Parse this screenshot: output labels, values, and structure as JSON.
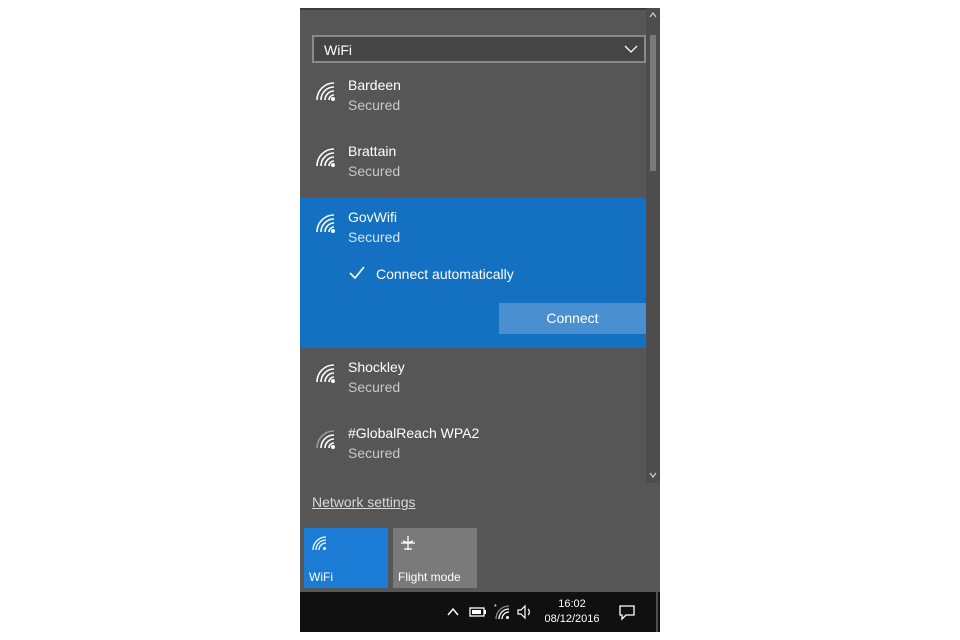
{
  "filter": {
    "value": "WiFi"
  },
  "networks": [
    {
      "name": "Bardeen",
      "status": "Secured"
    },
    {
      "name": "Brattain",
      "status": "Secured"
    },
    {
      "name": "GovWifi",
      "status": "Secured",
      "connect_auto_label": "Connect automatically",
      "connect_auto_checked": true,
      "connect_label": "Connect"
    },
    {
      "name": "Shockley",
      "status": "Secured"
    },
    {
      "name": "#GlobalReach WPA2",
      "status": "Secured"
    }
  ],
  "network_settings_label": "Network settings",
  "quick_actions": [
    {
      "label": "WiFi",
      "icon": "wifi-icon",
      "active": true
    },
    {
      "label": "Flight mode",
      "icon": "airplane-icon",
      "active": false
    }
  ],
  "taskbar": {
    "time": "16:02",
    "date": "08/12/2016",
    "icons": [
      "chevron-up-icon",
      "battery-icon",
      "wifi-icon",
      "volume-icon",
      "action-center-icon"
    ]
  },
  "colors": {
    "accent": "#1470c0",
    "flyout_bg": "#565656",
    "taskbar_bg": "#101010"
  }
}
